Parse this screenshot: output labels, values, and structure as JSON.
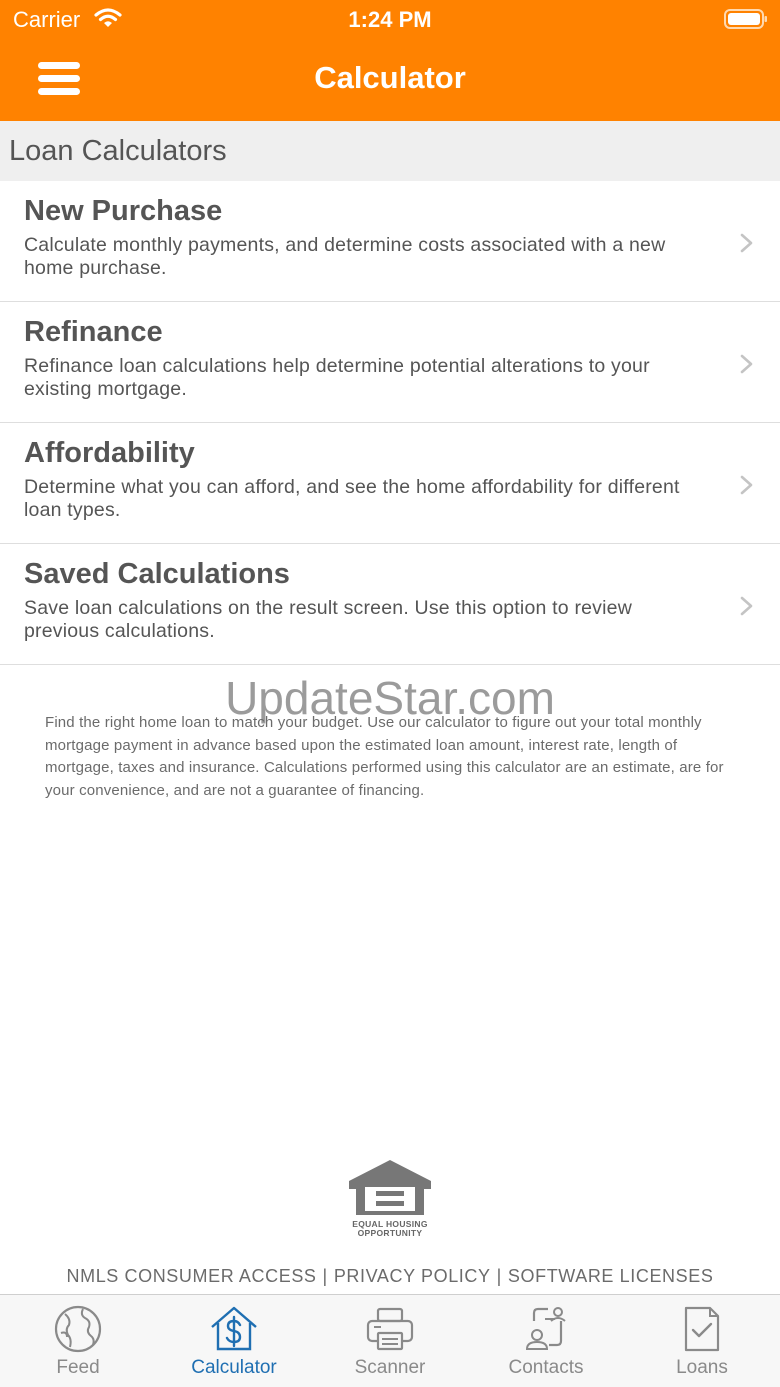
{
  "status_bar": {
    "carrier": "Carrier",
    "time": "1:24 PM"
  },
  "nav": {
    "title": "Calculator",
    "menu_icon": "hamburger-menu-icon"
  },
  "section": {
    "title": "Loan Calculators"
  },
  "calculators": [
    {
      "title": "New Purchase",
      "description": "Calculate monthly payments, and determine costs associated with a new home purchase."
    },
    {
      "title": "Refinance",
      "description": "Refinance loan calculations help determine potential alterations to your existing mortgage."
    },
    {
      "title": "Affordability",
      "description": "Determine what you can afford, and see the home affordability for different loan types."
    },
    {
      "title": "Saved Calculations",
      "description": "Save loan calculations on the result screen. Use this option to review previous calculations."
    }
  ],
  "watermark": "UpdateStar.com",
  "disclaimer": "Find the right home loan to match your budget. Use our calculator to figure out your total monthly mortgage payment in advance based upon the estimated loan amount, interest rate, length of mortgage, taxes and insurance. Calculations performed using this calculator are an estimate, are for your convenience, and are not a guarantee of financing.",
  "eho": {
    "line1": "EQUAL HOUSING",
    "line2": "OPPORTUNITY"
  },
  "footer": {
    "links": [
      "NMLS CONSUMER ACCESS",
      "PRIVACY POLICY",
      "SOFTWARE LICENSES"
    ],
    "separator": "|"
  },
  "tabs": [
    {
      "label": "Feed",
      "icon": "globe-icon",
      "active": false
    },
    {
      "label": "Calculator",
      "icon": "house-dollar-icon",
      "active": true
    },
    {
      "label": "Scanner",
      "icon": "printer-icon",
      "active": false
    },
    {
      "label": "Contacts",
      "icon": "contact-card-icon",
      "active": false
    },
    {
      "label": "Loans",
      "icon": "document-check-icon",
      "active": false
    }
  ],
  "colors": {
    "brand_orange": "#ff8200",
    "active_tab_blue": "#1f6fb2",
    "inactive_gray": "#8a8a8a",
    "section_bg": "#efefef"
  }
}
